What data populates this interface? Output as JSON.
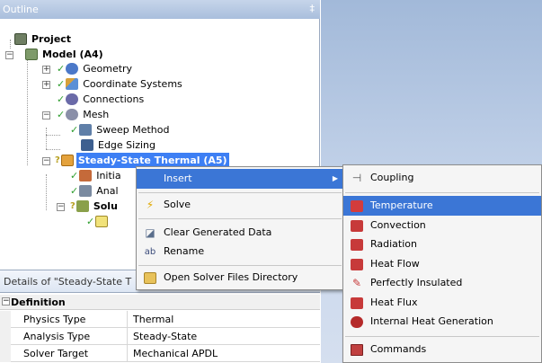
{
  "outline": {
    "title": "Outline",
    "pin_glyph": "‡",
    "tree": {
      "project": "Project",
      "model": "Model (A4)",
      "geometry": "Geometry",
      "coordinate_systems": "Coordinate Systems",
      "connections": "Connections",
      "mesh": "Mesh",
      "sweep_method": "Sweep Method",
      "edge_sizing": "Edge Sizing",
      "steady_state_thermal": "Steady-State Thermal (A5)",
      "initial_temperature": "Initia",
      "analysis_settings": "Anal",
      "solution": "Solu"
    }
  },
  "details": {
    "title": "Details of \"Steady-State T",
    "section": "Definition",
    "properties": [
      {
        "key": "Physics Type",
        "value": "Thermal"
      },
      {
        "key": "Analysis Type",
        "value": "Steady-State"
      },
      {
        "key": "Solver Target",
        "value": "Mechanical APDL"
      }
    ]
  },
  "context_menu": {
    "items": {
      "insert": "Insert",
      "solve": "Solve",
      "clear_generated_data": "Clear Generated Data",
      "rename": "Rename",
      "open_solver_files_directory": "Open Solver Files Directory"
    }
  },
  "insert_submenu": {
    "items": {
      "coupling": "Coupling",
      "temperature": "Temperature",
      "convection": "Convection",
      "radiation": "Radiation",
      "heat_flow": "Heat Flow",
      "perfectly_insulated": "Perfectly Insulated",
      "heat_flux": "Heat Flux",
      "internal_heat_generation": "Internal Heat Generation",
      "commands": "Commands"
    }
  },
  "colors": {
    "highlight": "#3b76d6",
    "selected_node": "#3d7ff4",
    "status_ok": "#2f9e2f",
    "status_pending": "#b8a020",
    "graphics_bg": "#b7c9e3"
  },
  "icons": {
    "project": "project-icon",
    "model": "model-icon",
    "geometry": "geometry-icon",
    "coordinate_systems": "coordinate-systems-icon",
    "connections": "connections-icon",
    "mesh": "mesh-icon",
    "solve": "lightning-icon",
    "rename": "rename-icon",
    "folder": "folder-icon"
  }
}
